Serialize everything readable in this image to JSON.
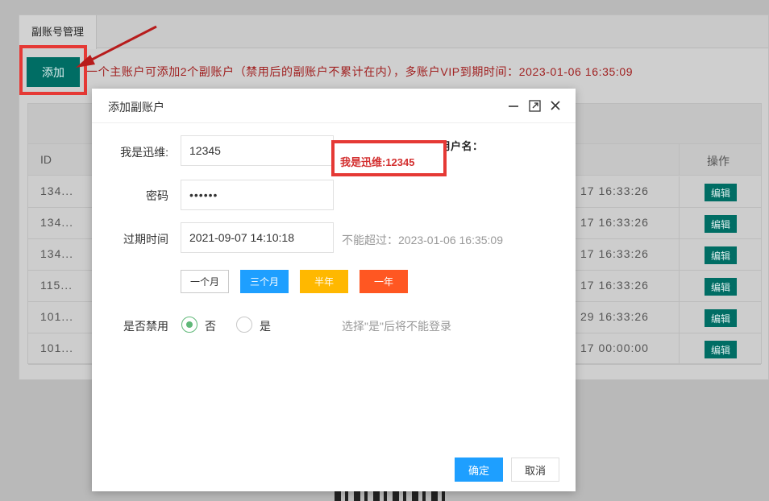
{
  "background": {
    "tab_label": "副账号管理",
    "add_label": "添加",
    "info_text": "一个主账户可添加2个副账户（禁用后的副账户不累计在内），多账户VIP到期时间：2023-01-06 16:35:09",
    "table": {
      "col_id": "ID",
      "col_op": "操作",
      "rows": [
        {
          "id": "134...",
          "time": "17 16:33:26",
          "edit": "编辑"
        },
        {
          "id": "134...",
          "time": "17 16:33:26",
          "edit": "编辑"
        },
        {
          "id": "134...",
          "time": "17 16:33:26",
          "edit": "编辑"
        },
        {
          "id": "115...",
          "time": "17 16:33:26",
          "edit": "编辑"
        },
        {
          "id": "101...",
          "time": "29 16:33:26",
          "edit": "编辑"
        },
        {
          "id": "101...",
          "time": "17 00:00:00",
          "edit": "编辑"
        }
      ]
    }
  },
  "dialog": {
    "title": "添加副账户",
    "icons": {
      "minimize": "minimize-icon",
      "maximize": "maximize-icon",
      "close": "close-icon"
    },
    "username": {
      "label": "我是迅维:",
      "value": "12345"
    },
    "hint_title": "副账号登录时请输入用户名：",
    "hint_value": "我是迅维:12345",
    "password": {
      "label": "密码",
      "value": "••••••"
    },
    "expire": {
      "label": "过期时间",
      "value": "2021-09-07 14:10:18",
      "hint": "不能超过：2023-01-06 16:35:09"
    },
    "durations": [
      {
        "label": "一个月",
        "bg": "#ffffff",
        "color": "#333333",
        "border": "#c9c9c9"
      },
      {
        "label": "三个月",
        "bg": "#1e9fff",
        "color": "#ffffff",
        "border": "#1e9fff"
      },
      {
        "label": "半年",
        "bg": "#ffb800",
        "color": "#ffffff",
        "border": "#ffb800"
      },
      {
        "label": "一年",
        "bg": "#ff5722",
        "color": "#ffffff",
        "border": "#ff5722"
      }
    ],
    "disable": {
      "label": "是否禁用",
      "no": "否",
      "yes": "是",
      "selected": "否",
      "hint": "选择\"是\"后将不能登录"
    },
    "confirm_label": "确定",
    "cancel_label": "取消"
  },
  "colors": {
    "primary": "#006d64",
    "confirm": "#1e9fff",
    "highlight": "#e53935",
    "info_text": "#a02020"
  }
}
